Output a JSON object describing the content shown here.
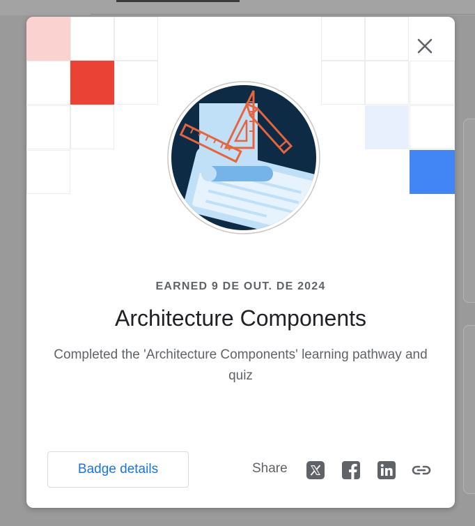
{
  "dialog": {
    "close_icon": "close-icon",
    "earned_text": "EARNED 9 DE OUT. DE 2024",
    "title": "Architecture Components",
    "description": "Completed the 'Architecture Components' learning pathway and quiz",
    "details_button_label": "Badge details",
    "share_label": "Share",
    "share_icons": [
      "x-twitter-icon",
      "facebook-icon",
      "linkedin-icon",
      "link-icon"
    ]
  },
  "colors": {
    "accent_red": "#ea4335",
    "light_red": "#fad2cf",
    "accent_blue": "#4285f4",
    "light_blue": "#e8f0fe",
    "link_blue": "#1a73e8",
    "badge_background": "#0d2b45",
    "badge_orange": "#e8643c"
  }
}
